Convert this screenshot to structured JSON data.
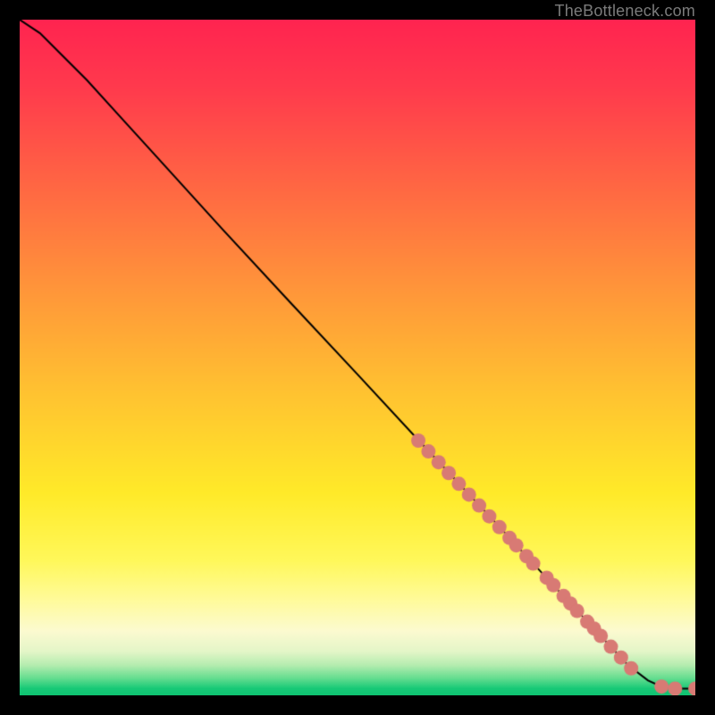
{
  "attribution": "TheBottleneck.com",
  "chart_data": {
    "type": "line",
    "title": "",
    "xlabel": "",
    "ylabel": "",
    "xlim": [
      0,
      100
    ],
    "ylim": [
      0,
      100
    ],
    "grid": false,
    "series": [
      {
        "name": "curve",
        "kind": "line",
        "color": "#000000",
        "x": [
          0,
          3,
          6,
          10,
          15,
          20,
          30,
          40,
          50,
          60,
          70,
          80,
          90,
          93,
          95,
          97,
          100
        ],
        "y": [
          100,
          98,
          95,
          91,
          85.5,
          80,
          69,
          58.2,
          47.5,
          36.7,
          26,
          15.2,
          4.5,
          2.2,
          1.3,
          1,
          1
        ]
      },
      {
        "name": "markers",
        "kind": "scatter",
        "color": "#d87a74",
        "radius": 8,
        "x": [
          59,
          60.5,
          62,
          63.5,
          65,
          66.5,
          68,
          69.5,
          71,
          72.5,
          73.5,
          75,
          76,
          78,
          79,
          80.5,
          81.5,
          82.5,
          84,
          85,
          86,
          87.5,
          89,
          90.5,
          95,
          97,
          100
        ],
        "y": [
          37.7,
          36.1,
          34.5,
          32.9,
          31.3,
          29.7,
          28.1,
          26.5,
          24.9,
          23.3,
          22.2,
          20.6,
          19.5,
          17.4,
          16.3,
          14.7,
          13.6,
          12.5,
          10.9,
          9.9,
          8.8,
          7.2,
          5.6,
          4,
          1.3,
          1,
          1
        ]
      }
    ],
    "background_gradient_stops": [
      {
        "pos": 0.0,
        "color": "#ff2450"
      },
      {
        "pos": 0.1,
        "color": "#ff3a4d"
      },
      {
        "pos": 0.25,
        "color": "#ff6843"
      },
      {
        "pos": 0.4,
        "color": "#ff963a"
      },
      {
        "pos": 0.55,
        "color": "#ffc231"
      },
      {
        "pos": 0.7,
        "color": "#ffea29"
      },
      {
        "pos": 0.8,
        "color": "#fff85a"
      },
      {
        "pos": 0.86,
        "color": "#fffb9c"
      },
      {
        "pos": 0.905,
        "color": "#fcfad0"
      },
      {
        "pos": 0.935,
        "color": "#e4f6c8"
      },
      {
        "pos": 0.955,
        "color": "#b6edb0"
      },
      {
        "pos": 0.975,
        "color": "#63dd8f"
      },
      {
        "pos": 0.99,
        "color": "#17c977"
      },
      {
        "pos": 1.0,
        "color": "#0fc372"
      }
    ]
  }
}
